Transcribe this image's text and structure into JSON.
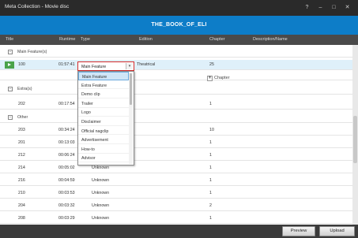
{
  "window": {
    "title": "Meta Collection - Movie disc",
    "controls": [
      "?",
      "–",
      "□",
      "✕"
    ]
  },
  "banner": {
    "title": "THE_BOOK_OF_ELI"
  },
  "columns": [
    "Title",
    "Runtime",
    "Type",
    "Edition",
    "Chapter",
    "Description/Name"
  ],
  "groups": {
    "main": "Main Feature(s)",
    "extras": "Extra(s)",
    "other": "Other"
  },
  "rows": {
    "main_row": {
      "title": "100",
      "runtime": "01:57:41",
      "type": "Main Feature",
      "edition": "Theatrical",
      "chapter": "25"
    },
    "add_chapter": "Chapter",
    "extra_row": {
      "title": "202",
      "runtime": "00:17:54",
      "chapter": "1"
    },
    "other_rows": [
      {
        "title": "203",
        "runtime": "00:34:24",
        "type": "",
        "chapter": "10"
      },
      {
        "title": "201",
        "runtime": "00:13:03",
        "type": "",
        "chapter": "1"
      },
      {
        "title": "212",
        "runtime": "00:06:24",
        "type": "",
        "chapter": "1"
      },
      {
        "title": "214",
        "runtime": "00:05:02",
        "type": "Unknown",
        "chapter": "1"
      },
      {
        "title": "216",
        "runtime": "00:04:59",
        "type": "Unknown",
        "chapter": "1"
      },
      {
        "title": "210",
        "runtime": "00:03:53",
        "type": "Unknown",
        "chapter": "1"
      },
      {
        "title": "204",
        "runtime": "00:03:32",
        "type": "Unknown",
        "chapter": "2"
      },
      {
        "title": "208",
        "runtime": "00:03:29",
        "type": "Unknown",
        "chapter": "1"
      }
    ]
  },
  "type_dropdown": {
    "selected": "Main Feature",
    "options": [
      "Main Feature",
      "Extra Feature",
      "Demo clip",
      "Trailer",
      "Logo",
      "Disclaimer",
      "Official nagclip",
      "Advertisement",
      "How-to",
      "Advisor"
    ]
  },
  "footer": {
    "preview": "Preview",
    "upload": "Upload"
  },
  "colors": {
    "accent": "#0d7dc8",
    "highlight": "#d42b2b",
    "play": "#4aa24a"
  }
}
